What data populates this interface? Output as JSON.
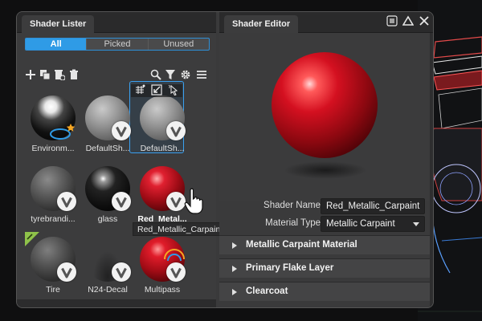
{
  "lister": {
    "tab_title": "Shader Lister",
    "filters": [
      {
        "label": "All",
        "active": true
      },
      {
        "label": "Picked",
        "active": false
      },
      {
        "label": "Unused",
        "active": false
      }
    ],
    "toolbar_icons": [
      "add-icon",
      "duplicate-icon",
      "delete-unused-icon",
      "delete-icon",
      "search-icon",
      "filter-icon",
      "gear-icon",
      "menu-icon"
    ],
    "shaders": [
      {
        "label": "Environm...",
        "kind": "environment"
      },
      {
        "label": "DefaultSh...",
        "kind": "grey"
      },
      {
        "label": "DefaultSh...",
        "kind": "grey"
      },
      {
        "label": "tyrebrandi...",
        "kind": "darkgrey"
      },
      {
        "label": "glass",
        "kind": "black"
      },
      {
        "label": "Red_Metal...",
        "kind": "red",
        "selected": true
      },
      {
        "label": "Tire",
        "kind": "darkgrey"
      },
      {
        "label": "N24-Decal",
        "kind": "decal"
      },
      {
        "label": "Multipass",
        "kind": "red"
      }
    ],
    "hover_icons": [
      "grid-icon",
      "apply-icon",
      "pick-icon"
    ],
    "tooltip": "Red_Metallic_Carpaint"
  },
  "editor": {
    "tab_title": "Shader Editor",
    "window_controls": [
      "menu-icon",
      "expand-icon",
      "close-icon"
    ],
    "fields": {
      "shader_name_label": "Shader Name",
      "shader_name_value": "Red_Metallic_Carpaint",
      "material_type_label": "Material Type",
      "material_type_value": "Metallic Carpaint"
    },
    "sections": [
      "Metallic Carpaint Material",
      "Primary Flake Layer",
      "Clearcoat"
    ]
  },
  "colors": {
    "accent": "#2f9be6",
    "panel_bg": "#3a3a3b",
    "ball_red": "#d41020"
  }
}
